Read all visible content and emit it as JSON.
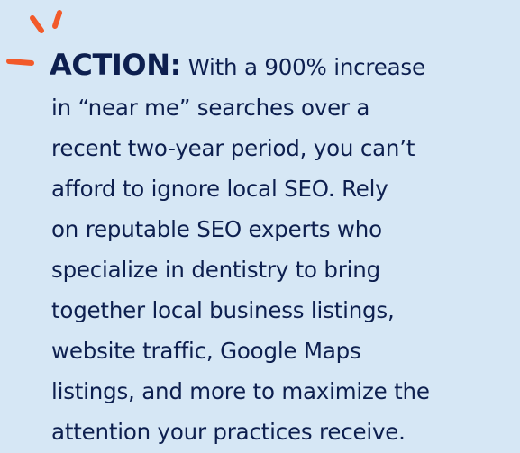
{
  "colors": {
    "background": "#d6e7f5",
    "text": "#0d1f4f",
    "accent": "#f25a2a"
  },
  "accent_icon": "emphasis-lines-icon",
  "callout": {
    "label": "ACTION:",
    "lines": [
      "With a 900% increase",
      "in “near me” searches over a",
      "recent two-year period, you can’t",
      "afford to ignore local SEO. Rely",
      "on reputable SEO experts who",
      "specialize in dentistry to bring",
      "together local business listings,",
      "website traffic, Google Maps",
      "listings, and more to maximize the",
      "attention your practices receive."
    ]
  }
}
